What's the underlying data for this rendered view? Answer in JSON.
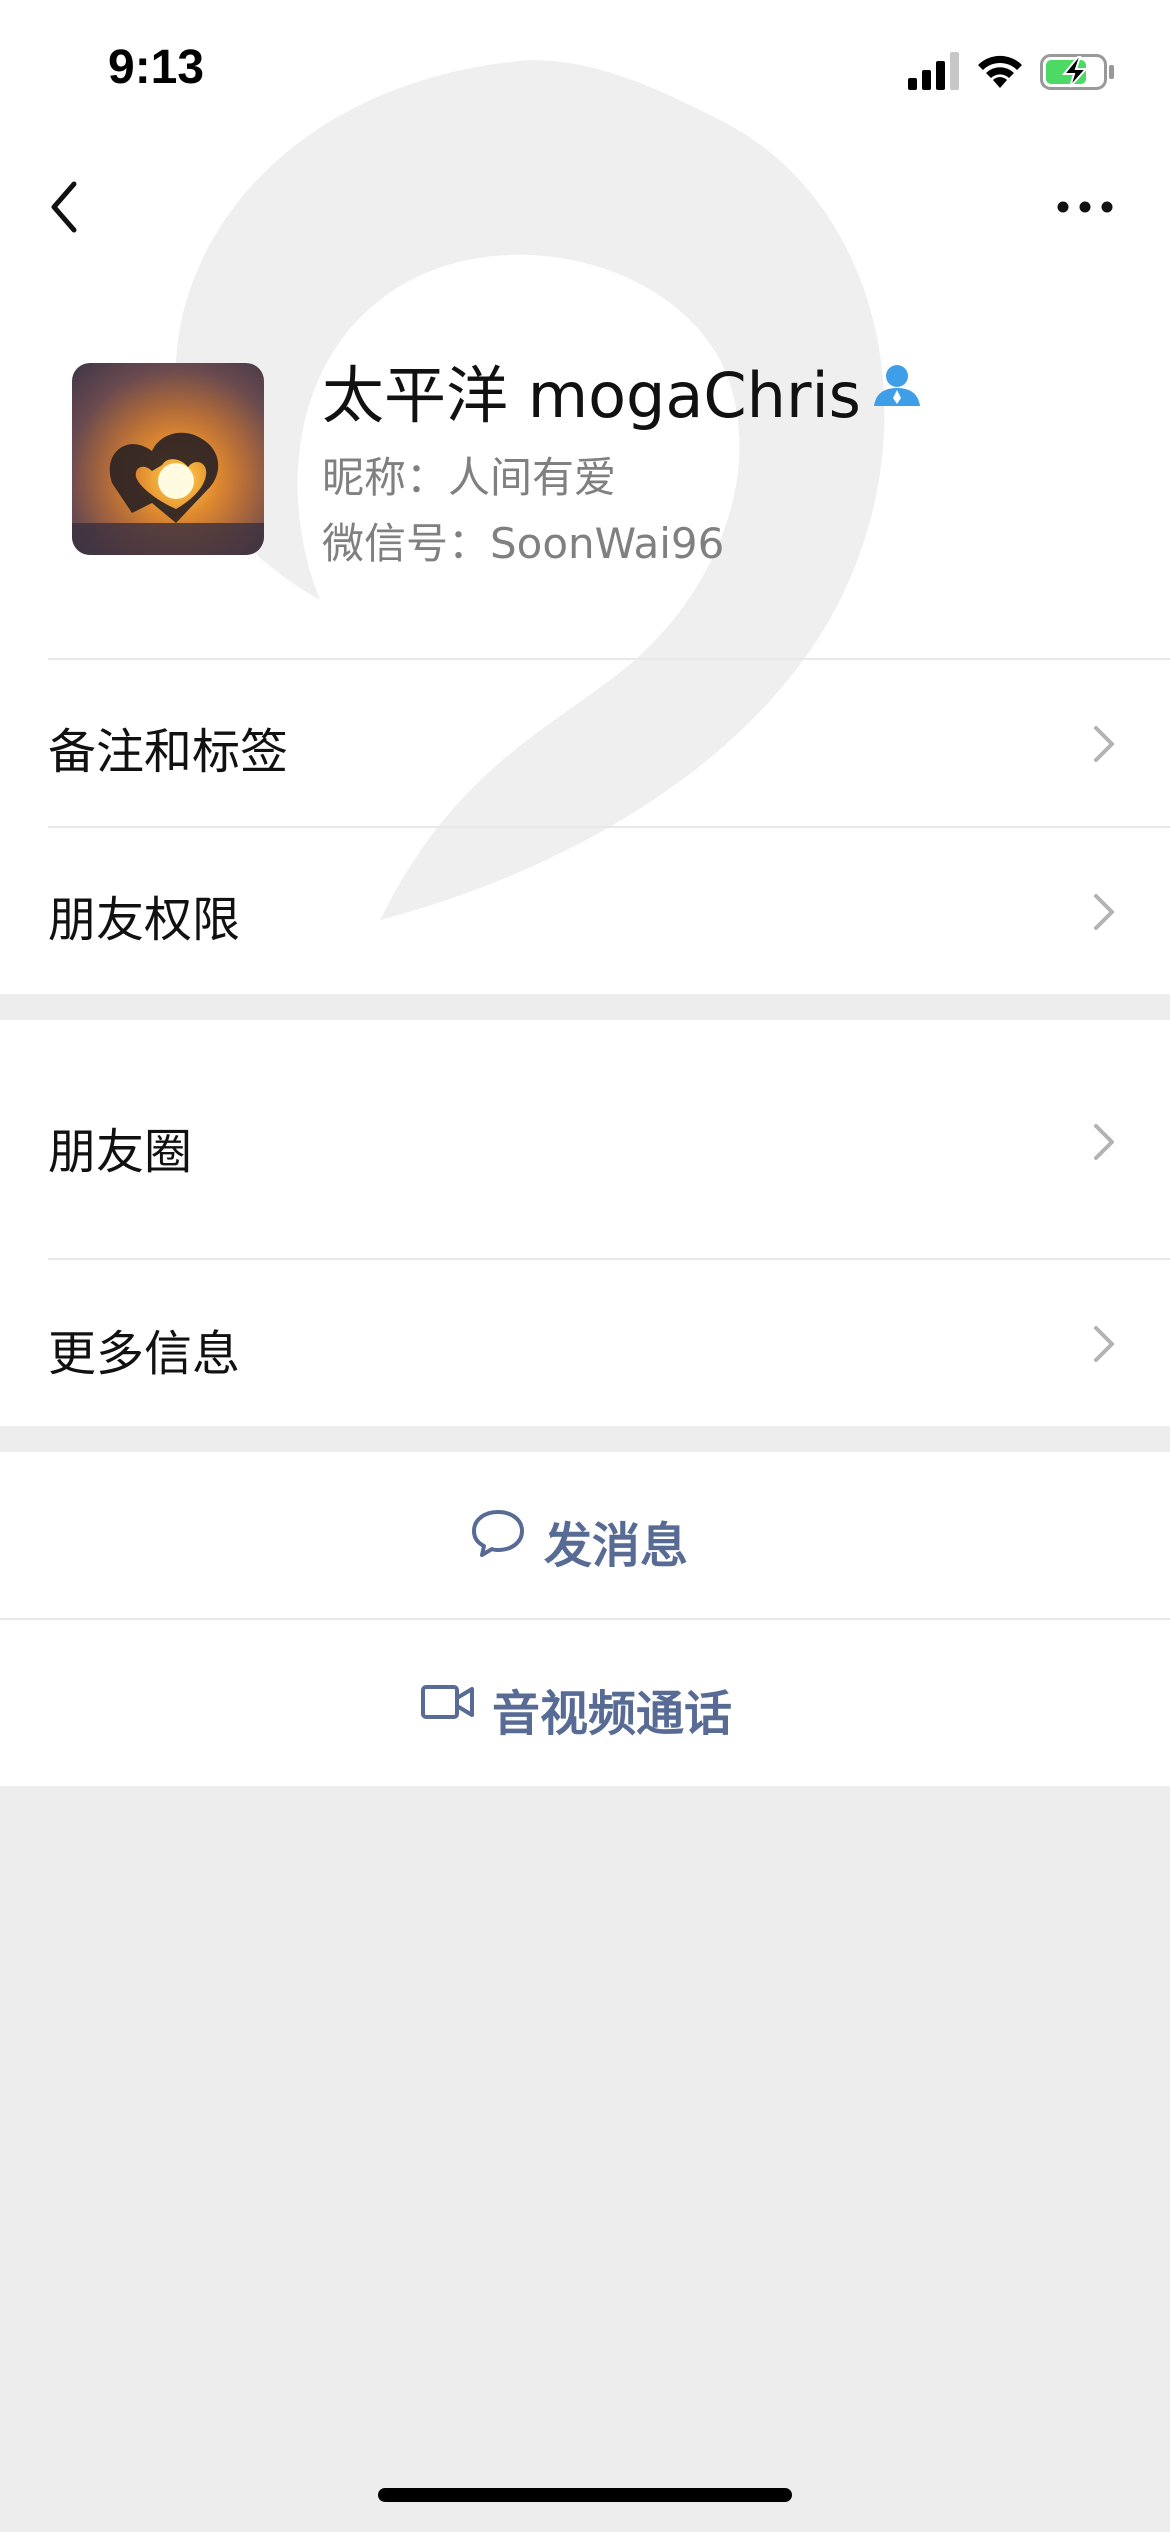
{
  "status_bar": {
    "time": "9:13"
  },
  "profile": {
    "name": "太平洋 mogaChris",
    "nickname": "昵称：人间有爱",
    "wechat_id": "微信号：SoonWai96"
  },
  "sections": {
    "remark_tags": "备注和标签",
    "friend_permissions": "朋友权限",
    "moments": "朋友圈",
    "more_info": "更多信息"
  },
  "actions": {
    "send_message": "发消息",
    "video_call": "音视频通话"
  },
  "colors": {
    "link_blue": "#576b95",
    "badge_blue": "#3f9ee8",
    "battery_green": "#4cd964"
  },
  "icons": [
    "back-icon",
    "more-icon",
    "badge-icon",
    "chevron-right-icon",
    "chat-bubble-icon",
    "video-camera-icon"
  ]
}
